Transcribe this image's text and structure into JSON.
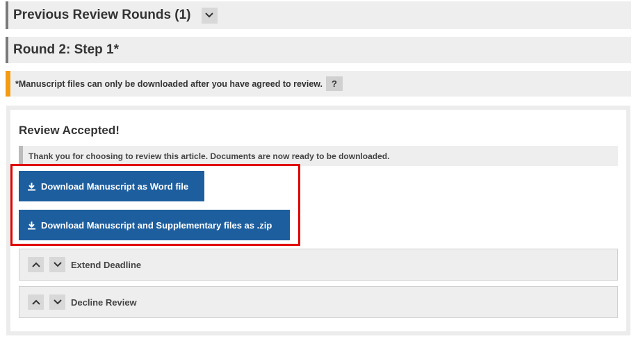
{
  "previous_rounds": {
    "title": "Previous Review Rounds (1)",
    "toggle_icon": "chevron-down-icon"
  },
  "round": {
    "title": "Round 2: Step 1*"
  },
  "notice": {
    "text": "*Manuscript files can only be downloaded after you have agreed to review.",
    "help_label": "?",
    "accent_color": "#f39c12"
  },
  "review_panel": {
    "title": "Review Accepted!",
    "message": "Thank you for choosing to review this article. Documents are now ready to be downloaded.",
    "download_word_label": "Download Manuscript as Word file",
    "download_zip_label": "Download Manuscript and Supplementary files as .zip",
    "button_color": "#1d5e9f",
    "highlight_color": "#e00000"
  },
  "accordions": [
    {
      "label": "Extend Deadline"
    },
    {
      "label": "Decline Review"
    }
  ]
}
